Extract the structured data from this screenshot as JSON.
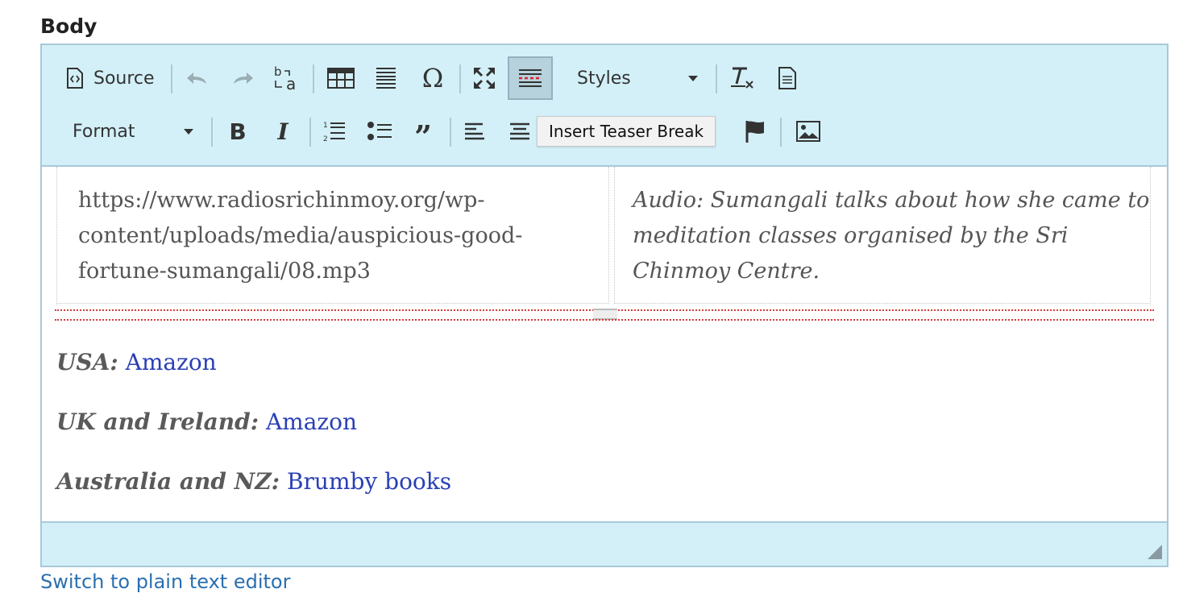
{
  "field": {
    "label": "Body"
  },
  "toolbar": {
    "source_label": "Source",
    "styles_label": "Styles",
    "format_label": "Format",
    "tooltip": "Insert Teaser Break",
    "icons": {
      "source": "source-icon",
      "undo": "undo-icon",
      "redo": "redo-icon",
      "replace": "find-replace-icon",
      "table": "table-icon",
      "hr": "horizontal-rule-icon",
      "special": "special-character-icon",
      "maximize": "maximize-icon",
      "teaser": "teaser-break-icon",
      "remove_format": "remove-format-icon",
      "templates": "templates-icon",
      "bold": "bold-icon",
      "italic": "italic-icon",
      "numbered": "numbered-list-icon",
      "bulleted": "bulleted-list-icon",
      "blockquote": "blockquote-icon",
      "align_left": "align-left-icon",
      "align_center": "align-center-icon",
      "anchor": "anchor-flag-icon",
      "image": "image-icon"
    },
    "colors": {
      "bar": "#d3f0f8",
      "active": "#b6d2dc"
    }
  },
  "content": {
    "table_row": {
      "left": "https://www.radiosrichinmoy.org/wp-content/uploads/media/auspicious-good-fortune-sumangali/08.mp3",
      "right": "Audio: Sumangali talks about how she came to meditation classes organised by the Sri Chinmoy Centre."
    },
    "paragraphs": [
      {
        "label": "USA:",
        "link": "Amazon"
      },
      {
        "label": "UK and Ireland:",
        "link": "Amazon"
      },
      {
        "label": "Australia and NZ:",
        "link": "Brumby books"
      }
    ],
    "colors": {
      "link": "#2a3fb5",
      "teaser_line": "#d63b3b"
    }
  },
  "footer": {
    "switch_link": "Switch to plain text editor"
  }
}
